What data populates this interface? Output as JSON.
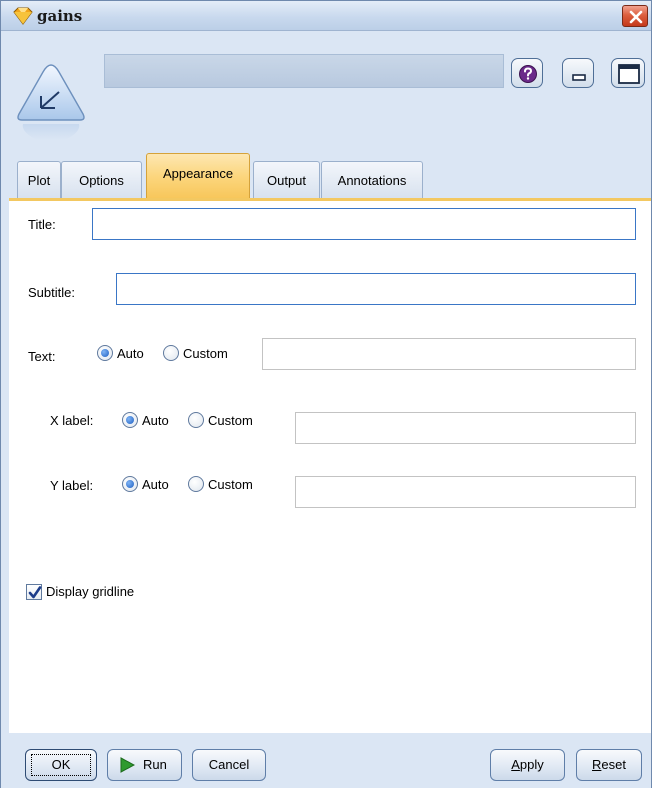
{
  "window": {
    "title": "gains",
    "close_icon": "close-icon",
    "app_icon": "gem-icon"
  },
  "header": {
    "node_icon": "plot-node-icon",
    "name_value": "",
    "help_icon": "help-icon",
    "minimize_icon": "minimize-icon",
    "maximize_icon": "maximize-icon"
  },
  "tabs": [
    {
      "label": "Plot",
      "active": false
    },
    {
      "label": "Options",
      "active": false
    },
    {
      "label": "Appearance",
      "active": true
    },
    {
      "label": "Output",
      "active": false
    },
    {
      "label": "Annotations",
      "active": false
    }
  ],
  "form": {
    "title_label": "Title:",
    "title_value": "",
    "subtitle_label": "Subtitle:",
    "subtitle_value": "",
    "text_label": "Text:",
    "text_mode": "Auto",
    "text_value": "",
    "xlabel_label": "X label:",
    "xlabel_mode": "Auto",
    "xlabel_value": "",
    "ylabel_label": "Y label:",
    "ylabel_mode": "Auto",
    "ylabel_value": "",
    "radio_auto": "Auto",
    "radio_custom": "Custom",
    "gridline_label": "Display gridline",
    "gridline_checked": true
  },
  "buttons": {
    "ok": "OK",
    "run": "Run",
    "cancel": "Cancel",
    "apply_u": "A",
    "apply_rest": "pply",
    "reset_u": "R",
    "reset_rest": "eset"
  },
  "colors": {
    "window_bg": "#dbe6f4",
    "active_tab": "#fcd67d",
    "run_arrow": "#2f9a2f",
    "close_button": "#dc5f3f"
  }
}
